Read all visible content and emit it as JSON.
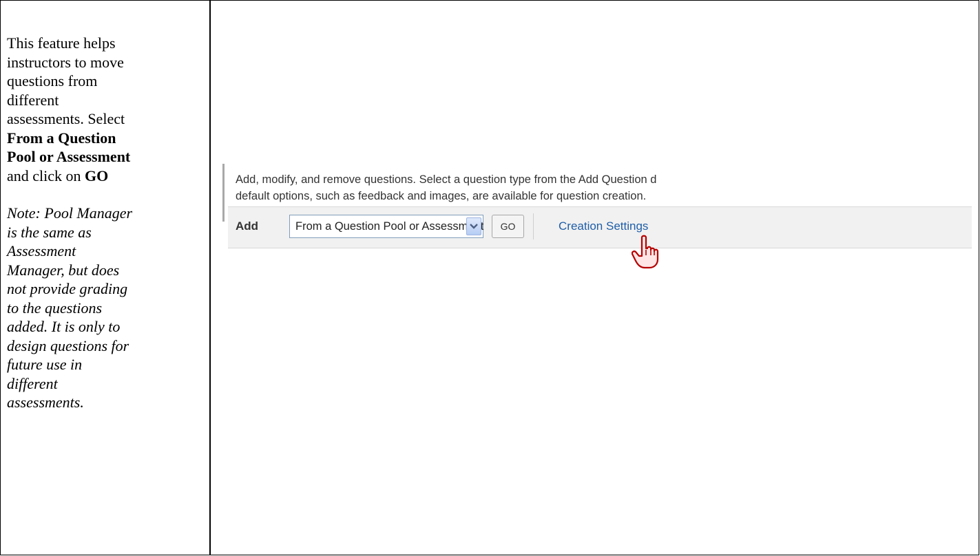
{
  "left_cell": {
    "line1": "This feature helps",
    "line2": "instructors to move",
    "line3": "questions from",
    "line4": "different",
    "line5": "assessments. Select",
    "bold1": "From a Question",
    "bold2": "Pool or Assessment",
    "and_click": "and click on ",
    "bold3": "GO",
    "note_lines": [
      "Note: Pool Manager",
      "is the same as",
      "Assessment",
      "Manager, but does",
      "not provide grading",
      "to the questions",
      "added. It is only to",
      "design questions for",
      "future use in",
      "different",
      "assessments."
    ]
  },
  "screenshot": {
    "instructions_line1": "Add, modify, and remove questions. Select a question type from the Add Question d",
    "instructions_line2": "default options, such as feedback and images, are available for question creation.",
    "add_label": "Add",
    "select_value": "From a Question Pool or Assessment",
    "go_label": "GO",
    "creation_settings_link": "Creation Settings",
    "colors": {
      "link": "#1f5ea8",
      "toolbar_bg": "#f1f1f1"
    },
    "icons": [
      "chevron-down-icon",
      "hand-cursor-icon"
    ]
  }
}
